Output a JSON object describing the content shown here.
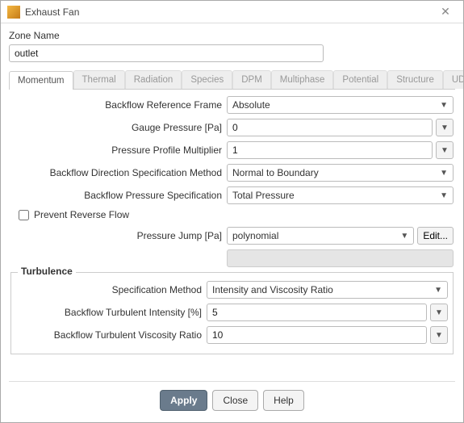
{
  "window": {
    "title": "Exhaust Fan"
  },
  "zone": {
    "label": "Zone Name",
    "value": "outlet"
  },
  "tabs": [
    "Momentum",
    "Thermal",
    "Radiation",
    "Species",
    "DPM",
    "Multiphase",
    "Potential",
    "Structure",
    "UDS"
  ],
  "form": {
    "backflow_ref_frame": {
      "label": "Backflow Reference Frame",
      "value": "Absolute"
    },
    "gauge_pressure": {
      "label": "Gauge Pressure [Pa]",
      "value": "0"
    },
    "pressure_profile_multiplier": {
      "label": "Pressure Profile Multiplier",
      "value": "1"
    },
    "backflow_dir_spec": {
      "label": "Backflow Direction Specification Method",
      "value": "Normal to Boundary"
    },
    "backflow_pressure_spec": {
      "label": "Backflow Pressure Specification",
      "value": "Total Pressure"
    },
    "prevent_reverse": {
      "label": "Prevent Reverse Flow"
    },
    "pressure_jump": {
      "label": "Pressure Jump [Pa]",
      "value": "polynomial",
      "edit": "Edit..."
    }
  },
  "turbulence": {
    "title": "Turbulence",
    "spec_method": {
      "label": "Specification Method",
      "value": "Intensity and Viscosity Ratio"
    },
    "turb_intensity": {
      "label": "Backflow Turbulent Intensity [%]",
      "value": "5"
    },
    "turb_viscosity_ratio": {
      "label": "Backflow Turbulent Viscosity Ratio",
      "value": "10"
    }
  },
  "buttons": {
    "apply": "Apply",
    "close": "Close",
    "help": "Help"
  }
}
